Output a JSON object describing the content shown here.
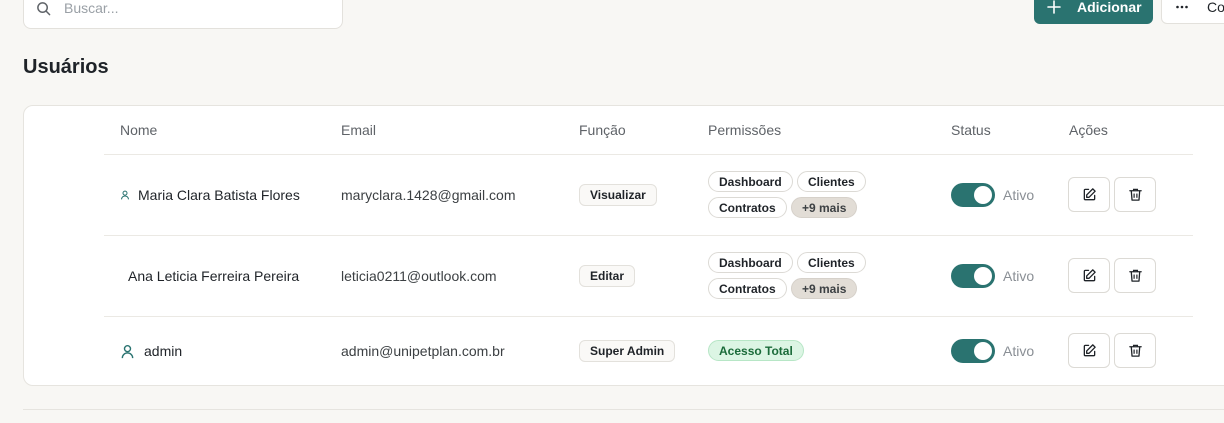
{
  "search": {
    "placeholder": "Buscar..."
  },
  "toolbar": {
    "add_label": "Adicionar",
    "more_label": "Co"
  },
  "section": {
    "title": "Usuários"
  },
  "table": {
    "headers": [
      "Nome",
      "Email",
      "Função",
      "Permissões",
      "Status",
      "Ações"
    ],
    "rows": [
      {
        "name": "Maria Clara Batista Flores",
        "email": "maryclara.1428@gmail.com",
        "role": "Visualizar",
        "permissions": [
          "Dashboard",
          "Clientes",
          "Contratos"
        ],
        "more": "+9 mais",
        "status": "Ativo",
        "active": true
      },
      {
        "name": "Ana Leticia Ferreira Pereira",
        "email": "leticia0211@outlook.com",
        "role": "Editar",
        "permissions": [
          "Dashboard",
          "Clientes",
          "Contratos"
        ],
        "more": "+9 mais",
        "status": "Ativo",
        "active": true
      },
      {
        "name": "admin",
        "email": "admin@unipetplan.com.br",
        "role": "Super Admin",
        "permissions": [
          "Acesso Total"
        ],
        "status": "Ativo",
        "active": true
      }
    ]
  },
  "colors": {
    "accent": "#2a7370",
    "full_access_bg": "#dcf5e4",
    "more_badge_bg": "#e2ddd6"
  }
}
